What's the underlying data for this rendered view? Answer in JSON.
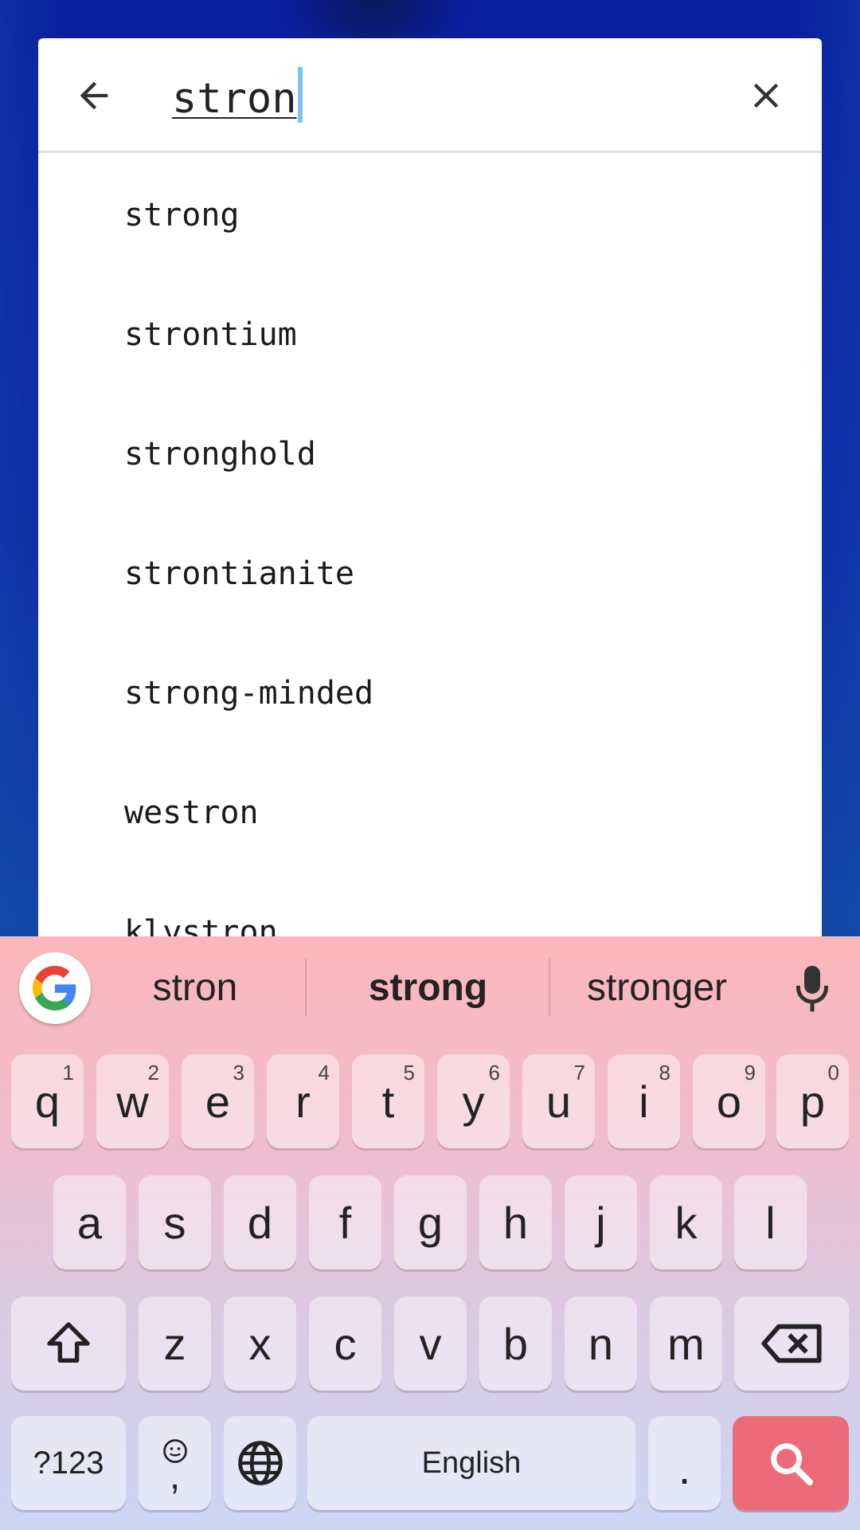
{
  "search": {
    "query": "stron",
    "suggestions": [
      "strong",
      "strontium",
      "stronghold",
      "strontianite",
      "strong-minded",
      "westron",
      "klystron"
    ]
  },
  "keyboard": {
    "suggestions": [
      "stron",
      "strong",
      "stronger"
    ],
    "row1": [
      {
        "key": "q",
        "hint": "1"
      },
      {
        "key": "w",
        "hint": "2"
      },
      {
        "key": "e",
        "hint": "3"
      },
      {
        "key": "r",
        "hint": "4"
      },
      {
        "key": "t",
        "hint": "5"
      },
      {
        "key": "y",
        "hint": "6"
      },
      {
        "key": "u",
        "hint": "7"
      },
      {
        "key": "i",
        "hint": "8"
      },
      {
        "key": "o",
        "hint": "9"
      },
      {
        "key": "p",
        "hint": "0"
      }
    ],
    "row2": [
      "a",
      "s",
      "d",
      "f",
      "g",
      "h",
      "j",
      "k",
      "l"
    ],
    "row3": [
      "z",
      "x",
      "c",
      "v",
      "b",
      "n",
      "m"
    ],
    "symbols_label": "?123",
    "comma_label": ",",
    "space_label": "English",
    "period_label": ".",
    "icons": {
      "google": "google-g-icon",
      "mic": "mic-icon",
      "shift": "shift-icon",
      "backspace": "backspace-icon",
      "emoji": "emoji-icon",
      "globe": "globe-icon",
      "search": "search-icon"
    },
    "colors": {
      "search_key": "#ec6b78"
    }
  }
}
